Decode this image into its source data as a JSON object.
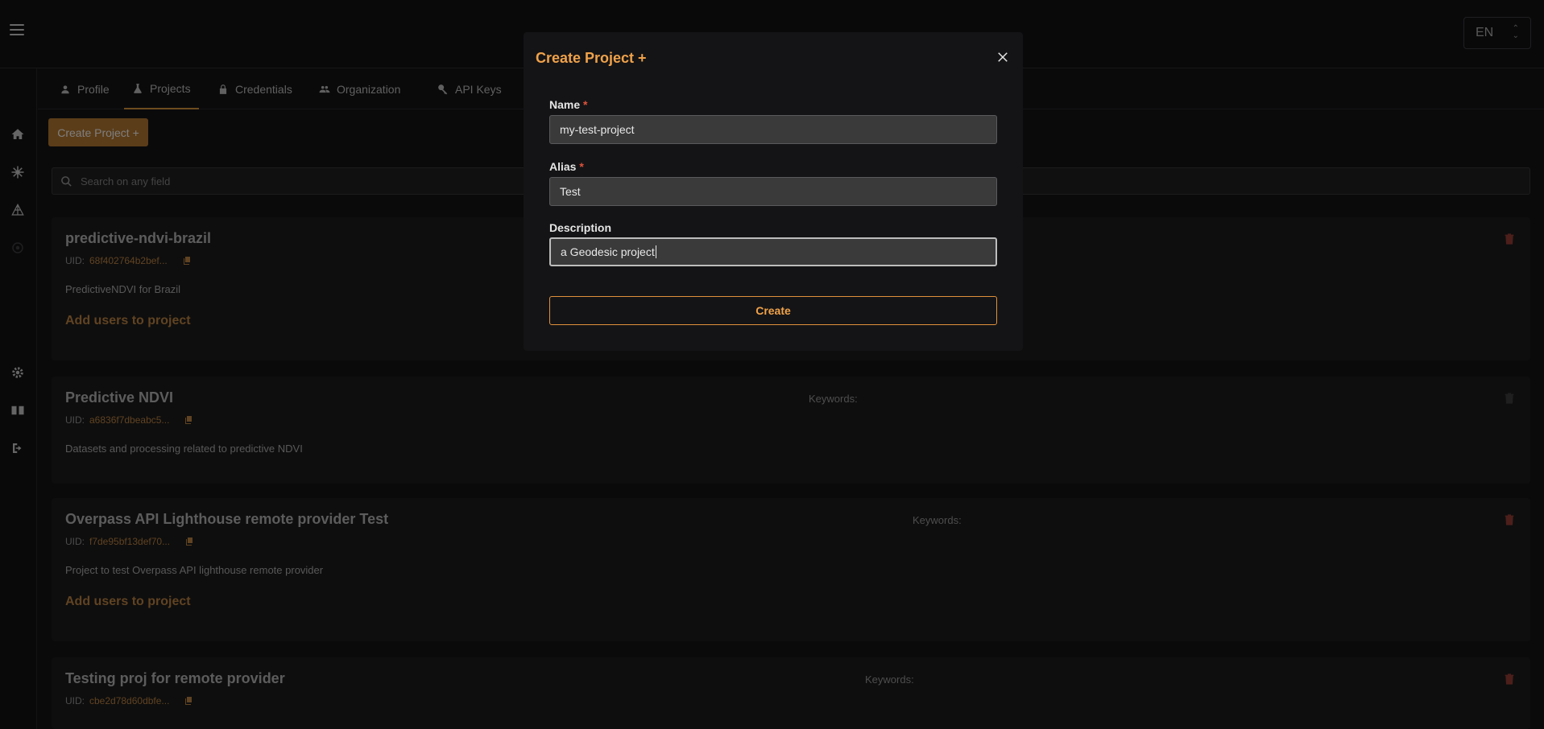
{
  "topbar": {
    "language": "EN"
  },
  "tabs": [
    {
      "label": "Profile",
      "icon": "person-icon"
    },
    {
      "label": "Projects",
      "icon": "flask-icon"
    },
    {
      "label": "Credentials",
      "icon": "lock-icon"
    },
    {
      "label": "Organization",
      "icon": "users-icon"
    },
    {
      "label": "API Keys",
      "icon": "key-icon"
    }
  ],
  "create_project_button": "Create Project +",
  "search": {
    "placeholder": "Search on any field"
  },
  "projects": [
    {
      "title": "predictive-ndvi-brazil",
      "uid_label": "UID:",
      "uid": "68f402764b2bef...",
      "description": "PredictiveNDVI for Brazil",
      "add_users": "Add users to project",
      "keywords_label": ""
    },
    {
      "title": "Predictive NDVI",
      "uid_label": "UID:",
      "uid": "a6836f7dbeabc5...",
      "description": "Datasets and processing related to predictive NDVI",
      "add_users": "",
      "keywords_label": "Keywords:"
    },
    {
      "title": "Overpass API Lighthouse remote provider Test",
      "uid_label": "UID:",
      "uid": "f7de95bf13def70...",
      "description": "Project to test Overpass API lighthouse remote provider",
      "add_users": "Add users to project",
      "keywords_label": "Keywords:"
    },
    {
      "title": "Testing proj for remote provider",
      "uid_label": "UID:",
      "uid": "cbe2d78d60dbfe...",
      "description": "",
      "add_users": "",
      "keywords_label": "Keywords:"
    }
  ],
  "modal": {
    "title": "Create Project +",
    "name_label": "Name",
    "name_value": "my-test-project",
    "alias_label": "Alias",
    "alias_value": "Test",
    "description_label": "Description",
    "description_value": "a Geodesic project",
    "required_mark": "*",
    "create_button": "Create"
  },
  "colors": {
    "accent": "#f0a24a",
    "background": "#131314",
    "danger": "#e0523c"
  }
}
